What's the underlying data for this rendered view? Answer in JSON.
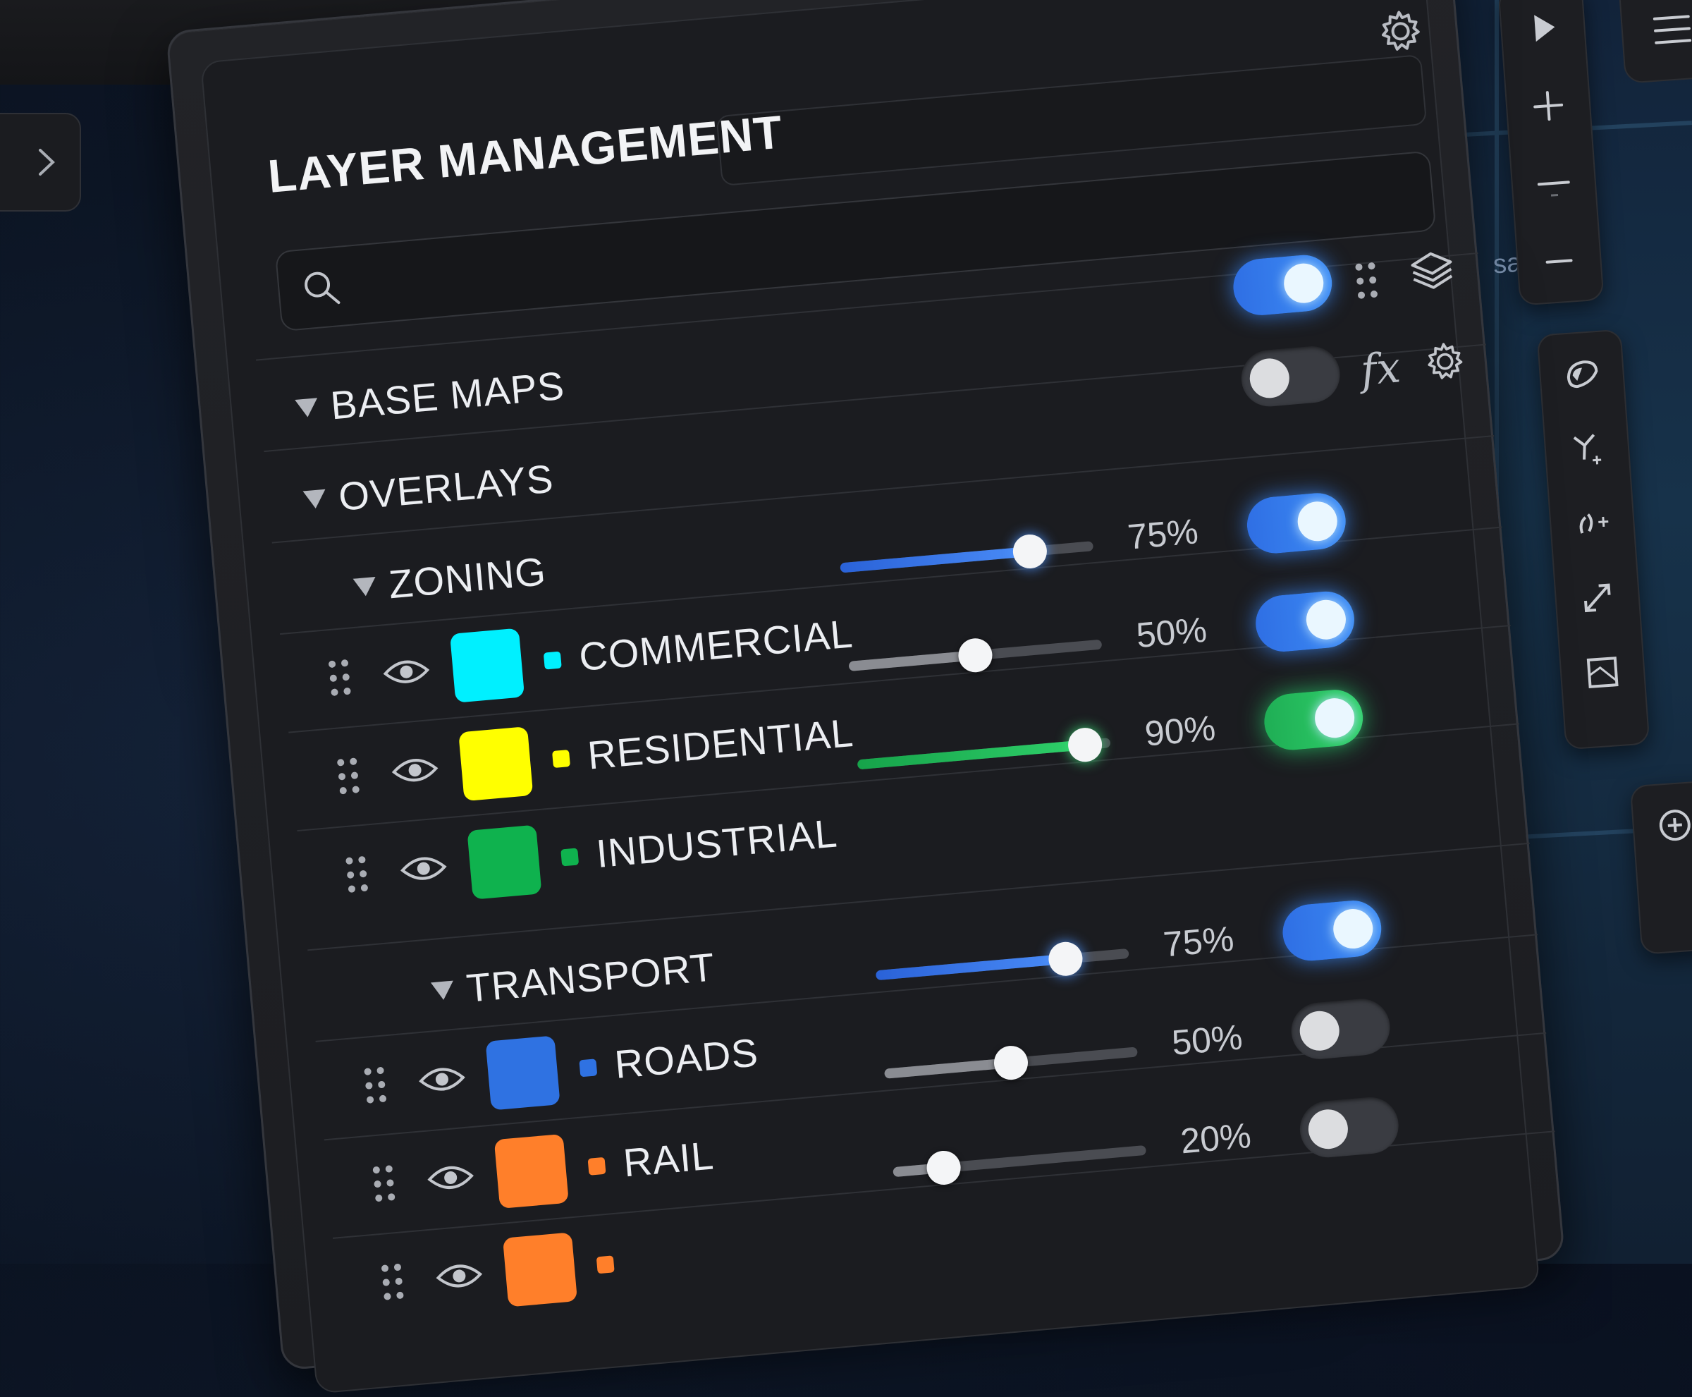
{
  "panel": {
    "title": "LAYER MANAGEMENT",
    "search_placeholder": ""
  },
  "map": {
    "partial_label": "sata"
  },
  "groups": {
    "base_maps": {
      "label": "BASE MAPS",
      "enabled": true
    },
    "overlays": {
      "label": "OVERLAYS",
      "enabled": false,
      "fx_label": "fx"
    },
    "zoning": {
      "label": "ZONING"
    },
    "transport": {
      "label": "TRANSPORT"
    }
  },
  "layers": [
    {
      "name": "COMMERCIAL",
      "color": "#00f0ff",
      "opacity_pct": 75,
      "opacity_label": "75%",
      "enabled": true,
      "accent": "#3b82f6"
    },
    {
      "name": "RESIDENTIAL",
      "color": "#ffff00",
      "opacity_pct": 50,
      "opacity_label": "50%",
      "enabled": true,
      "accent": "#9a9ca2"
    },
    {
      "name": "INDUSTRIAL",
      "color": "#0fb24e",
      "opacity_pct": 90,
      "opacity_label": "90%",
      "enabled": true,
      "accent": "#22c55e"
    },
    {
      "name": "ROADS",
      "color": "#2f72e2",
      "opacity_pct": 75,
      "opacity_label": "75%",
      "enabled": true,
      "accent": "#3b82f6"
    },
    {
      "name": "RAIL",
      "color": "#ff7f2a",
      "opacity_pct": 50,
      "opacity_label": "50%",
      "enabled": false,
      "accent": "#9a9ca2"
    },
    {
      "name": "",
      "color": "#ff7f2a",
      "opacity_pct": 20,
      "opacity_label": "20%",
      "enabled": false,
      "accent": "#9a9ca2"
    }
  ],
  "colors": {
    "accent_blue": "#3d8cf5",
    "accent_green": "#2fd06a",
    "panel_bg": "#1c1d21"
  },
  "toolbar_icons": [
    "play-icon",
    "zoom-in-icon",
    "zoom-out-icon",
    "minus-icon",
    "draw-polygon-icon",
    "add-vertex-icon",
    "edit-vertex-icon",
    "resize-icon",
    "map-frame-icon",
    "add-circle-icon",
    "menu-icon"
  ]
}
